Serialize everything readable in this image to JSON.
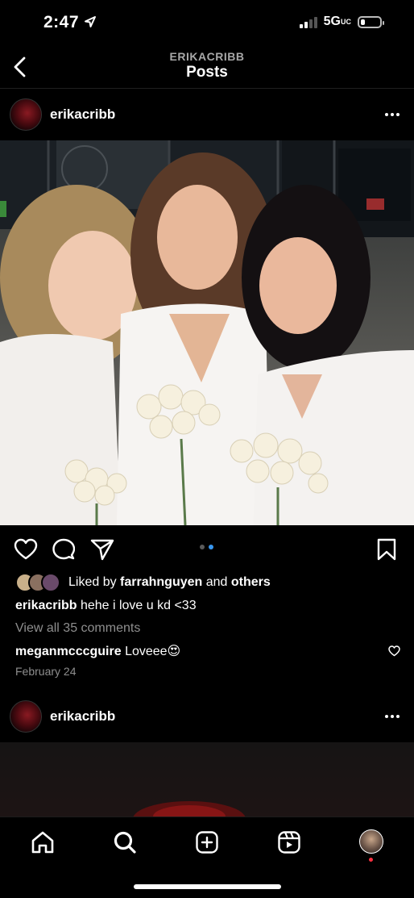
{
  "status": {
    "time": "2:47",
    "network": "5G",
    "network_sub": "UC"
  },
  "header": {
    "subtitle": "ERIKACRIBB",
    "title": "Posts"
  },
  "post1": {
    "username": "erikacribb",
    "carousel": {
      "count": 2,
      "active_index": 1
    },
    "likes": {
      "prefix": "Liked by",
      "user": "farrahnguyen",
      "and": "and",
      "others": "others"
    },
    "caption": {
      "user": "erikacribb",
      "text": "hehe i love u kd <33"
    },
    "view_comments": "View all 35 comments",
    "comment": {
      "user": "meganmcccguire",
      "text": "Loveee😍"
    },
    "date": "February 24"
  },
  "post2": {
    "username": "erikacribb"
  },
  "nav": {
    "items": [
      "home-icon",
      "search-icon",
      "create-icon",
      "reels-icon",
      "profile-avatar"
    ]
  },
  "colors": {
    "background": "#000000",
    "accent": "#3897f0",
    "muted": "#8e8e8e"
  }
}
